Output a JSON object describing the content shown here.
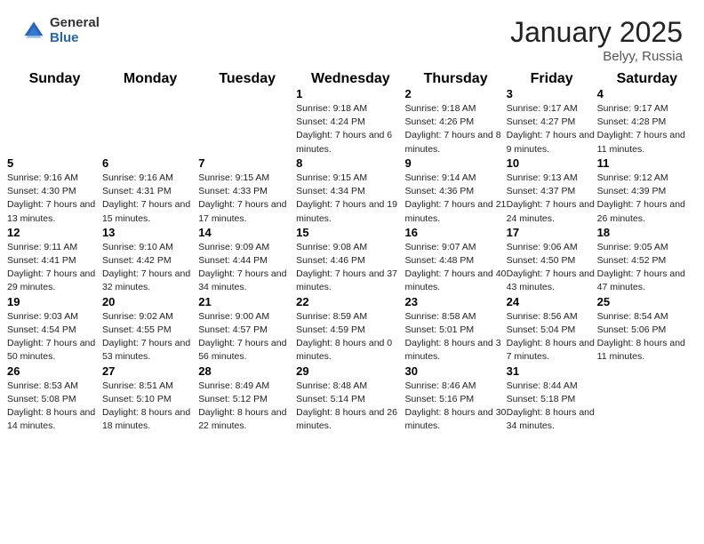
{
  "header": {
    "logo_general": "General",
    "logo_blue": "Blue",
    "month": "January 2025",
    "location": "Belyy, Russia"
  },
  "weekdays": [
    "Sunday",
    "Monday",
    "Tuesday",
    "Wednesday",
    "Thursday",
    "Friday",
    "Saturday"
  ],
  "weeks": [
    [
      {
        "day": "",
        "sunrise": "",
        "sunset": "",
        "daylight": ""
      },
      {
        "day": "",
        "sunrise": "",
        "sunset": "",
        "daylight": ""
      },
      {
        "day": "",
        "sunrise": "",
        "sunset": "",
        "daylight": ""
      },
      {
        "day": "1",
        "sunrise": "Sunrise: 9:18 AM",
        "sunset": "Sunset: 4:24 PM",
        "daylight": "Daylight: 7 hours and 6 minutes."
      },
      {
        "day": "2",
        "sunrise": "Sunrise: 9:18 AM",
        "sunset": "Sunset: 4:26 PM",
        "daylight": "Daylight: 7 hours and 8 minutes."
      },
      {
        "day": "3",
        "sunrise": "Sunrise: 9:17 AM",
        "sunset": "Sunset: 4:27 PM",
        "daylight": "Daylight: 7 hours and 9 minutes."
      },
      {
        "day": "4",
        "sunrise": "Sunrise: 9:17 AM",
        "sunset": "Sunset: 4:28 PM",
        "daylight": "Daylight: 7 hours and 11 minutes."
      }
    ],
    [
      {
        "day": "5",
        "sunrise": "Sunrise: 9:16 AM",
        "sunset": "Sunset: 4:30 PM",
        "daylight": "Daylight: 7 hours and 13 minutes."
      },
      {
        "day": "6",
        "sunrise": "Sunrise: 9:16 AM",
        "sunset": "Sunset: 4:31 PM",
        "daylight": "Daylight: 7 hours and 15 minutes."
      },
      {
        "day": "7",
        "sunrise": "Sunrise: 9:15 AM",
        "sunset": "Sunset: 4:33 PM",
        "daylight": "Daylight: 7 hours and 17 minutes."
      },
      {
        "day": "8",
        "sunrise": "Sunrise: 9:15 AM",
        "sunset": "Sunset: 4:34 PM",
        "daylight": "Daylight: 7 hours and 19 minutes."
      },
      {
        "day": "9",
        "sunrise": "Sunrise: 9:14 AM",
        "sunset": "Sunset: 4:36 PM",
        "daylight": "Daylight: 7 hours and 21 minutes."
      },
      {
        "day": "10",
        "sunrise": "Sunrise: 9:13 AM",
        "sunset": "Sunset: 4:37 PM",
        "daylight": "Daylight: 7 hours and 24 minutes."
      },
      {
        "day": "11",
        "sunrise": "Sunrise: 9:12 AM",
        "sunset": "Sunset: 4:39 PM",
        "daylight": "Daylight: 7 hours and 26 minutes."
      }
    ],
    [
      {
        "day": "12",
        "sunrise": "Sunrise: 9:11 AM",
        "sunset": "Sunset: 4:41 PM",
        "daylight": "Daylight: 7 hours and 29 minutes."
      },
      {
        "day": "13",
        "sunrise": "Sunrise: 9:10 AM",
        "sunset": "Sunset: 4:42 PM",
        "daylight": "Daylight: 7 hours and 32 minutes."
      },
      {
        "day": "14",
        "sunrise": "Sunrise: 9:09 AM",
        "sunset": "Sunset: 4:44 PM",
        "daylight": "Daylight: 7 hours and 34 minutes."
      },
      {
        "day": "15",
        "sunrise": "Sunrise: 9:08 AM",
        "sunset": "Sunset: 4:46 PM",
        "daylight": "Daylight: 7 hours and 37 minutes."
      },
      {
        "day": "16",
        "sunrise": "Sunrise: 9:07 AM",
        "sunset": "Sunset: 4:48 PM",
        "daylight": "Daylight: 7 hours and 40 minutes."
      },
      {
        "day": "17",
        "sunrise": "Sunrise: 9:06 AM",
        "sunset": "Sunset: 4:50 PM",
        "daylight": "Daylight: 7 hours and 43 minutes."
      },
      {
        "day": "18",
        "sunrise": "Sunrise: 9:05 AM",
        "sunset": "Sunset: 4:52 PM",
        "daylight": "Daylight: 7 hours and 47 minutes."
      }
    ],
    [
      {
        "day": "19",
        "sunrise": "Sunrise: 9:03 AM",
        "sunset": "Sunset: 4:54 PM",
        "daylight": "Daylight: 7 hours and 50 minutes."
      },
      {
        "day": "20",
        "sunrise": "Sunrise: 9:02 AM",
        "sunset": "Sunset: 4:55 PM",
        "daylight": "Daylight: 7 hours and 53 minutes."
      },
      {
        "day": "21",
        "sunrise": "Sunrise: 9:00 AM",
        "sunset": "Sunset: 4:57 PM",
        "daylight": "Daylight: 7 hours and 56 minutes."
      },
      {
        "day": "22",
        "sunrise": "Sunrise: 8:59 AM",
        "sunset": "Sunset: 4:59 PM",
        "daylight": "Daylight: 8 hours and 0 minutes."
      },
      {
        "day": "23",
        "sunrise": "Sunrise: 8:58 AM",
        "sunset": "Sunset: 5:01 PM",
        "daylight": "Daylight: 8 hours and 3 minutes."
      },
      {
        "day": "24",
        "sunrise": "Sunrise: 8:56 AM",
        "sunset": "Sunset: 5:04 PM",
        "daylight": "Daylight: 8 hours and 7 minutes."
      },
      {
        "day": "25",
        "sunrise": "Sunrise: 8:54 AM",
        "sunset": "Sunset: 5:06 PM",
        "daylight": "Daylight: 8 hours and 11 minutes."
      }
    ],
    [
      {
        "day": "26",
        "sunrise": "Sunrise: 8:53 AM",
        "sunset": "Sunset: 5:08 PM",
        "daylight": "Daylight: 8 hours and 14 minutes."
      },
      {
        "day": "27",
        "sunrise": "Sunrise: 8:51 AM",
        "sunset": "Sunset: 5:10 PM",
        "daylight": "Daylight: 8 hours and 18 minutes."
      },
      {
        "day": "28",
        "sunrise": "Sunrise: 8:49 AM",
        "sunset": "Sunset: 5:12 PM",
        "daylight": "Daylight: 8 hours and 22 minutes."
      },
      {
        "day": "29",
        "sunrise": "Sunrise: 8:48 AM",
        "sunset": "Sunset: 5:14 PM",
        "daylight": "Daylight: 8 hours and 26 minutes."
      },
      {
        "day": "30",
        "sunrise": "Sunrise: 8:46 AM",
        "sunset": "Sunset: 5:16 PM",
        "daylight": "Daylight: 8 hours and 30 minutes."
      },
      {
        "day": "31",
        "sunrise": "Sunrise: 8:44 AM",
        "sunset": "Sunset: 5:18 PM",
        "daylight": "Daylight: 8 hours and 34 minutes."
      },
      {
        "day": "",
        "sunrise": "",
        "sunset": "",
        "daylight": ""
      }
    ]
  ]
}
